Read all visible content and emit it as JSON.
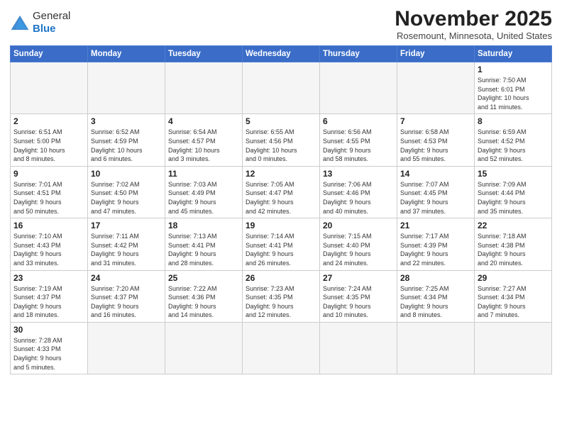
{
  "logo": {
    "text_general": "General",
    "text_blue": "Blue"
  },
  "title": "November 2025",
  "subtitle": "Rosemount, Minnesota, United States",
  "days_of_week": [
    "Sunday",
    "Monday",
    "Tuesday",
    "Wednesday",
    "Thursday",
    "Friday",
    "Saturday"
  ],
  "weeks": [
    [
      {
        "day": "",
        "info": ""
      },
      {
        "day": "",
        "info": ""
      },
      {
        "day": "",
        "info": ""
      },
      {
        "day": "",
        "info": ""
      },
      {
        "day": "",
        "info": ""
      },
      {
        "day": "",
        "info": ""
      },
      {
        "day": "1",
        "info": "Sunrise: 7:50 AM\nSunset: 6:01 PM\nDaylight: 10 hours\nand 11 minutes."
      }
    ],
    [
      {
        "day": "2",
        "info": "Sunrise: 6:51 AM\nSunset: 5:00 PM\nDaylight: 10 hours\nand 8 minutes."
      },
      {
        "day": "3",
        "info": "Sunrise: 6:52 AM\nSunset: 4:59 PM\nDaylight: 10 hours\nand 6 minutes."
      },
      {
        "day": "4",
        "info": "Sunrise: 6:54 AM\nSunset: 4:57 PM\nDaylight: 10 hours\nand 3 minutes."
      },
      {
        "day": "5",
        "info": "Sunrise: 6:55 AM\nSunset: 4:56 PM\nDaylight: 10 hours\nand 0 minutes."
      },
      {
        "day": "6",
        "info": "Sunrise: 6:56 AM\nSunset: 4:55 PM\nDaylight: 9 hours\nand 58 minutes."
      },
      {
        "day": "7",
        "info": "Sunrise: 6:58 AM\nSunset: 4:53 PM\nDaylight: 9 hours\nand 55 minutes."
      },
      {
        "day": "8",
        "info": "Sunrise: 6:59 AM\nSunset: 4:52 PM\nDaylight: 9 hours\nand 52 minutes."
      }
    ],
    [
      {
        "day": "9",
        "info": "Sunrise: 7:01 AM\nSunset: 4:51 PM\nDaylight: 9 hours\nand 50 minutes."
      },
      {
        "day": "10",
        "info": "Sunrise: 7:02 AM\nSunset: 4:50 PM\nDaylight: 9 hours\nand 47 minutes."
      },
      {
        "day": "11",
        "info": "Sunrise: 7:03 AM\nSunset: 4:49 PM\nDaylight: 9 hours\nand 45 minutes."
      },
      {
        "day": "12",
        "info": "Sunrise: 7:05 AM\nSunset: 4:47 PM\nDaylight: 9 hours\nand 42 minutes."
      },
      {
        "day": "13",
        "info": "Sunrise: 7:06 AM\nSunset: 4:46 PM\nDaylight: 9 hours\nand 40 minutes."
      },
      {
        "day": "14",
        "info": "Sunrise: 7:07 AM\nSunset: 4:45 PM\nDaylight: 9 hours\nand 37 minutes."
      },
      {
        "day": "15",
        "info": "Sunrise: 7:09 AM\nSunset: 4:44 PM\nDaylight: 9 hours\nand 35 minutes."
      }
    ],
    [
      {
        "day": "16",
        "info": "Sunrise: 7:10 AM\nSunset: 4:43 PM\nDaylight: 9 hours\nand 33 minutes."
      },
      {
        "day": "17",
        "info": "Sunrise: 7:11 AM\nSunset: 4:42 PM\nDaylight: 9 hours\nand 31 minutes."
      },
      {
        "day": "18",
        "info": "Sunrise: 7:13 AM\nSunset: 4:41 PM\nDaylight: 9 hours\nand 28 minutes."
      },
      {
        "day": "19",
        "info": "Sunrise: 7:14 AM\nSunset: 4:41 PM\nDaylight: 9 hours\nand 26 minutes."
      },
      {
        "day": "20",
        "info": "Sunrise: 7:15 AM\nSunset: 4:40 PM\nDaylight: 9 hours\nand 24 minutes."
      },
      {
        "day": "21",
        "info": "Sunrise: 7:17 AM\nSunset: 4:39 PM\nDaylight: 9 hours\nand 22 minutes."
      },
      {
        "day": "22",
        "info": "Sunrise: 7:18 AM\nSunset: 4:38 PM\nDaylight: 9 hours\nand 20 minutes."
      }
    ],
    [
      {
        "day": "23",
        "info": "Sunrise: 7:19 AM\nSunset: 4:37 PM\nDaylight: 9 hours\nand 18 minutes."
      },
      {
        "day": "24",
        "info": "Sunrise: 7:20 AM\nSunset: 4:37 PM\nDaylight: 9 hours\nand 16 minutes."
      },
      {
        "day": "25",
        "info": "Sunrise: 7:22 AM\nSunset: 4:36 PM\nDaylight: 9 hours\nand 14 minutes."
      },
      {
        "day": "26",
        "info": "Sunrise: 7:23 AM\nSunset: 4:35 PM\nDaylight: 9 hours\nand 12 minutes."
      },
      {
        "day": "27",
        "info": "Sunrise: 7:24 AM\nSunset: 4:35 PM\nDaylight: 9 hours\nand 10 minutes."
      },
      {
        "day": "28",
        "info": "Sunrise: 7:25 AM\nSunset: 4:34 PM\nDaylight: 9 hours\nand 8 minutes."
      },
      {
        "day": "29",
        "info": "Sunrise: 7:27 AM\nSunset: 4:34 PM\nDaylight: 9 hours\nand 7 minutes."
      }
    ],
    [
      {
        "day": "30",
        "info": "Sunrise: 7:28 AM\nSunset: 4:33 PM\nDaylight: 9 hours\nand 5 minutes."
      },
      {
        "day": "",
        "info": ""
      },
      {
        "day": "",
        "info": ""
      },
      {
        "day": "",
        "info": ""
      },
      {
        "day": "",
        "info": ""
      },
      {
        "day": "",
        "info": ""
      },
      {
        "day": "",
        "info": ""
      }
    ]
  ]
}
